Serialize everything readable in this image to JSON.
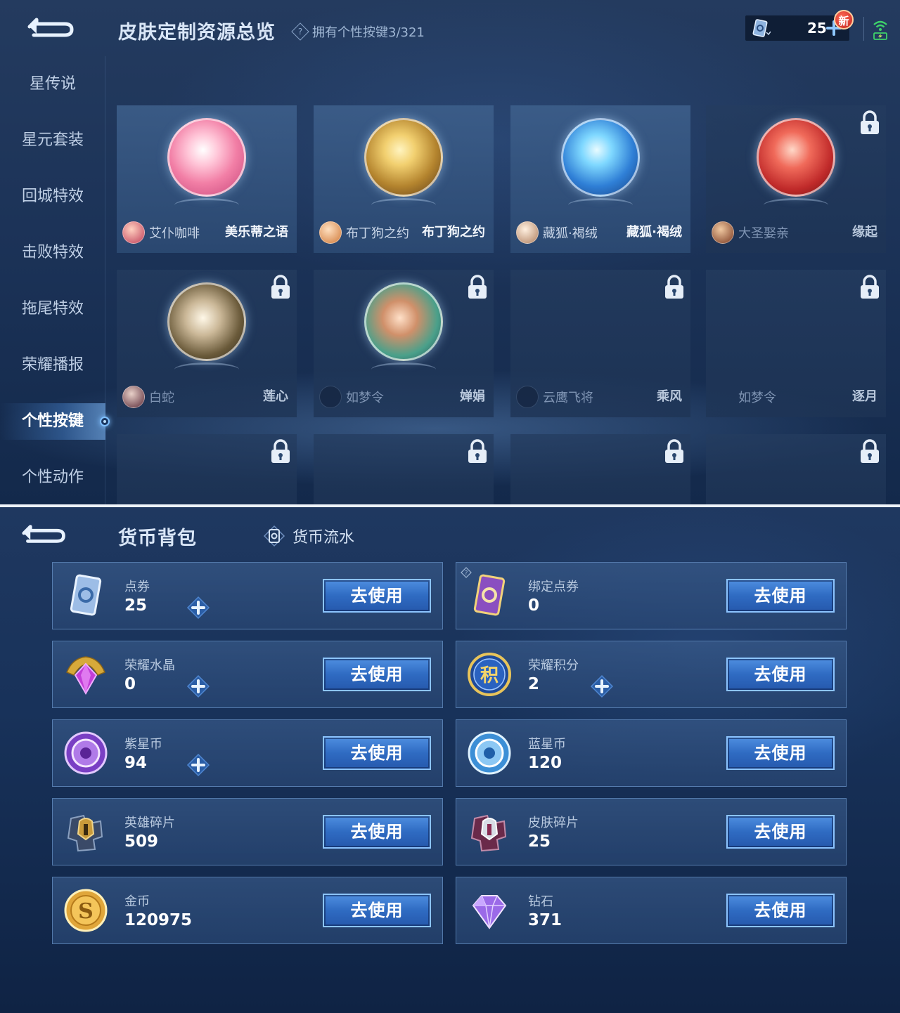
{
  "top": {
    "title": "皮肤定制资源总览",
    "owned_text": "拥有个性按键3/321",
    "help_glyph": "?",
    "ticket_count": "25",
    "new_badge": "新",
    "nav": [
      {
        "label": "星传说"
      },
      {
        "label": "星元套装"
      },
      {
        "label": "回城特效"
      },
      {
        "label": "击败特效"
      },
      {
        "label": "拖尾特效"
      },
      {
        "label": "荣耀播报"
      },
      {
        "label": "个性按键",
        "active": true
      },
      {
        "label": "个性动作"
      }
    ],
    "cards": [
      {
        "owner": "艾仆咖啡",
        "skin": "美乐蒂之语",
        "locked": false
      },
      {
        "owner": "布丁狗之约",
        "skin": "布丁狗之约",
        "locked": false
      },
      {
        "owner": "藏狐·褐绒",
        "skin": "藏狐·褐绒",
        "locked": false
      },
      {
        "owner": "大圣娶亲",
        "skin": "缘起",
        "locked": true
      },
      {
        "owner": "白蛇",
        "skin": "莲心",
        "locked": true
      },
      {
        "owner": "如梦令",
        "skin": "婵娟",
        "locked": true
      },
      {
        "owner": "云鹰飞将",
        "skin": "乘风",
        "locked": true
      },
      {
        "owner": "如梦令",
        "skin": "逐月",
        "locked": true
      }
    ],
    "colors": {
      "accent": "#7fc0ff",
      "card": "#3e608c",
      "lock": "#e6eef8"
    }
  },
  "bottom": {
    "title": "货币背包",
    "flow_label": "货币流水",
    "use_label": "去使用",
    "currencies": [
      {
        "name": "点券",
        "amount": "25",
        "icon": "ticket-icon",
        "has_plus": true
      },
      {
        "name": "绑定点券",
        "amount": "0",
        "icon": "bound-ticket-icon",
        "has_plus": false
      },
      {
        "name": "荣耀水晶",
        "amount": "0",
        "icon": "crystal-icon",
        "has_plus": true
      },
      {
        "name": "荣耀积分",
        "amount": "2",
        "icon": "points-icon",
        "has_plus": true
      },
      {
        "name": "紫星币",
        "amount": "94",
        "icon": "purple-coin-icon",
        "has_plus": true
      },
      {
        "name": "蓝星币",
        "amount": "120",
        "icon": "blue-coin-icon",
        "has_plus": false
      },
      {
        "name": "英雄碎片",
        "amount": "509",
        "icon": "hero-fragment-icon",
        "has_plus": false
      },
      {
        "name": "皮肤碎片",
        "amount": "25",
        "icon": "skin-fragment-icon",
        "has_plus": false
      },
      {
        "name": "金币",
        "amount": "120975",
        "icon": "gold-coin-icon",
        "has_plus": false
      },
      {
        "name": "钻石",
        "amount": "371",
        "icon": "diamond-icon",
        "has_plus": false
      }
    ],
    "points_glyph": "积",
    "gold_glyph": "S"
  }
}
